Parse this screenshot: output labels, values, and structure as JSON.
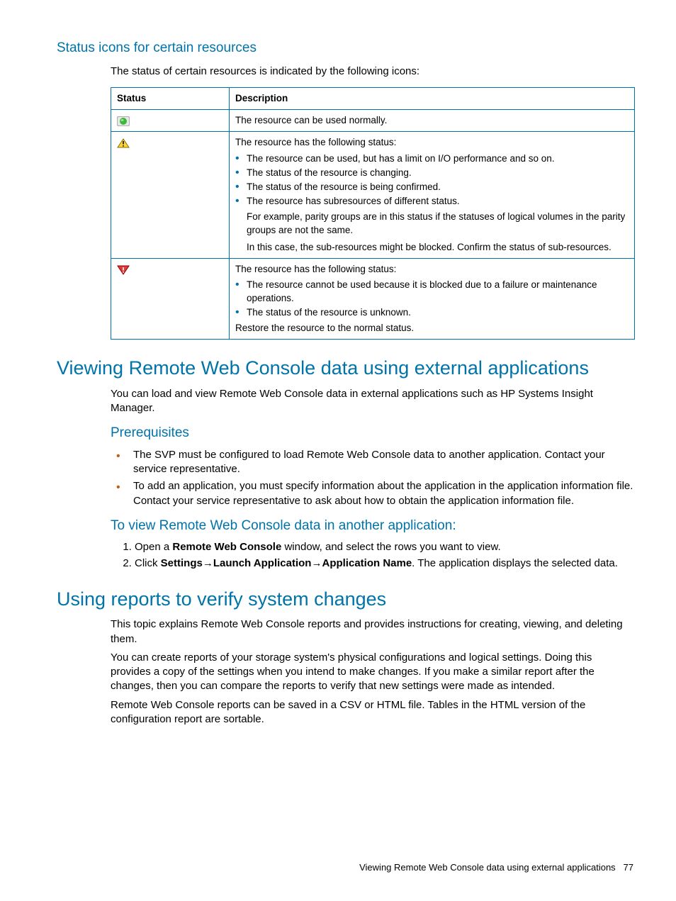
{
  "section1": {
    "heading": "Status icons for certain resources",
    "intro": "The status of certain resources is indicated by the following icons:",
    "table": {
      "header": {
        "col1": "Status",
        "col2": "Description"
      },
      "row1": {
        "desc": "The resource can be used normally."
      },
      "row2": {
        "desc_intro": "The resource has the following status:",
        "bullets": [
          "The resource can be used, but has a limit on I/O performance and so on.",
          "The status of the resource is changing.",
          "The status of the resource is being confirmed.",
          "The resource has subresources of different status."
        ],
        "para1": "For example, parity groups are in this status if the statuses of logical volumes in the parity groups are not the same.",
        "para2": "In this case, the sub-resources might be blocked. Confirm the status of sub-resources."
      },
      "row3": {
        "desc_intro": "The resource has the following status:",
        "bullets": [
          "The resource cannot be used because it is blocked due to a failure or maintenance operations.",
          "The status of the resource is unknown."
        ],
        "para1": "Restore the resource to the normal status."
      }
    }
  },
  "section2": {
    "heading": "Viewing Remote Web Console data using external applications",
    "intro": "You can load and view Remote Web Console data in external applications such as HP Systems Insight Manager.",
    "prereq_heading": "Prerequisites",
    "prereq_items": [
      "The SVP must be configured to load Remote Web Console data to another application. Contact your service representative.",
      "To add an application, you must specify information about the application in the application information file. Contact your service representative to ask about how to obtain the application information file."
    ],
    "todo_heading": "To view Remote Web Console data in another application:",
    "step1_pre": "Open a ",
    "step1_bold": "Remote Web Console",
    "step1_post": " window, and select the rows you want to view.",
    "step2_pre": "Click ",
    "step2_b1": "Settings",
    "step2_b2": "Launch Application",
    "step2_b3": "Application Name",
    "step2_post": ". The application displays the selected data."
  },
  "section3": {
    "heading": "Using reports to verify system changes",
    "p1": "This topic explains Remote Web Console reports and provides instructions for creating, viewing, and deleting them.",
    "p2": "You can create reports of your storage system's physical configurations and logical settings. Doing this provides a copy of the settings when you intend to make changes. If you make a similar report after the changes, then you can compare the reports to verify that new settings were made as intended.",
    "p3": "Remote Web Console reports can be saved in a CSV or HTML file. Tables in the HTML version of the configuration report are sortable."
  },
  "footer": {
    "text": "Viewing Remote Web Console data using external applications",
    "page": "77"
  },
  "icons": {
    "normal": "status-normal-icon",
    "warning": "status-warning-icon",
    "error": "status-error-icon"
  }
}
